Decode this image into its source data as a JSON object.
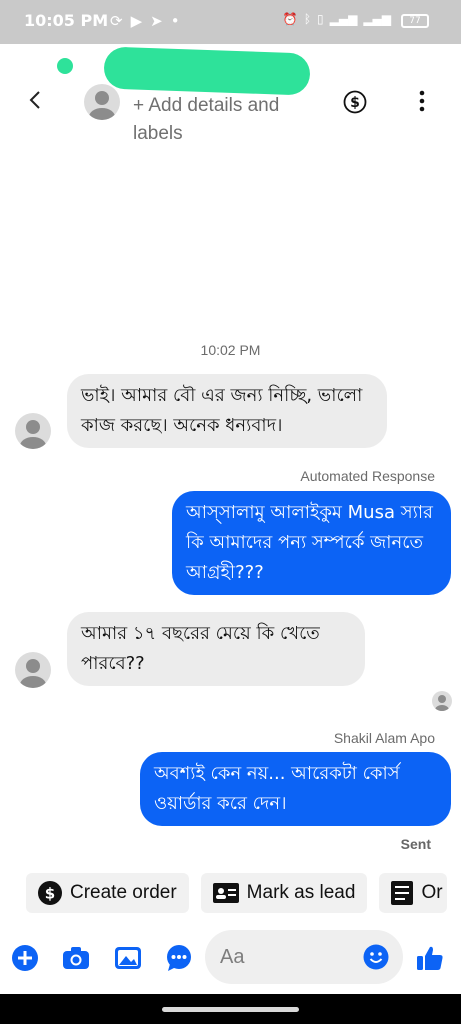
{
  "status_bar": {
    "time": "10:05 PM",
    "battery": "77"
  },
  "header": {
    "add_details": "+ Add details and labels"
  },
  "thread": {
    "timestamp": "10:02 PM",
    "messages": [
      {
        "direction": "incoming",
        "text": "ভাই। আমার বৌ এর জন্য নিচ্ছি, ভালো কাজ করছে। অনেক ধন্যবাদ।"
      },
      {
        "direction": "outgoing",
        "label": "Automated Response",
        "text": "আস্সালামু আলাইকুম Musa স্যার কি আমাদের পন্য সম্পর্কে জানতে আগ্রহী???"
      },
      {
        "direction": "incoming",
        "text": "আমার ১৭ বছরের মেয়ে কি খেতে পারবে??"
      },
      {
        "direction": "outgoing",
        "label": "Shakil Alam Apo",
        "text": "অবশ্যই কেন নয়... আরেকটা কোর্স ওয়ার্ডার করে দেন।"
      }
    ],
    "sent_status": "Sent"
  },
  "quick_actions": [
    {
      "label": "Create order",
      "icon": "dollar-circle-icon"
    },
    {
      "label": "Mark as lead",
      "icon": "id-card-icon"
    },
    {
      "label": "Or",
      "icon": "order-list-icon"
    }
  ],
  "composer": {
    "placeholder": "Aa"
  },
  "colors": {
    "accent": "#0c63f5",
    "incoming_bubble": "#ececec",
    "status_bar": "#c9c9c9"
  }
}
